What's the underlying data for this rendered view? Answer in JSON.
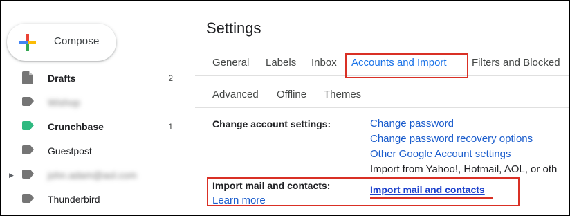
{
  "compose": {
    "label": "Compose"
  },
  "sidebar": {
    "items": [
      {
        "label": "Drafts",
        "count": "2",
        "bold": true,
        "icon": "draft-icon"
      },
      {
        "label": "Wishop",
        "count": "",
        "bold": false,
        "blurred": true,
        "icon": "label-icon",
        "color": "#757575"
      },
      {
        "label": "Crunchbase",
        "count": "1",
        "bold": true,
        "icon": "label-icon",
        "color": "#2fb980"
      },
      {
        "label": "Guestpost",
        "count": "",
        "bold": false,
        "icon": "label-icon",
        "color": "#757575"
      },
      {
        "label": "john.adam@aol.com",
        "count": "",
        "bold": false,
        "blurred": true,
        "expandable": true,
        "icon": "label-icon",
        "color": "#757575"
      },
      {
        "label": "Thunderbird",
        "count": "",
        "bold": false,
        "icon": "label-icon",
        "color": "#757575"
      }
    ]
  },
  "settings": {
    "title": "Settings",
    "tabs": [
      "General",
      "Labels",
      "Inbox",
      "Accounts and Import",
      "Filters and Blocked"
    ],
    "tabs_row2": [
      "Advanced",
      "Offline",
      "Themes"
    ],
    "active_tab": "Accounts and Import"
  },
  "account_section": {
    "label": "Change account settings:",
    "links": [
      "Change password",
      "Change password recovery options",
      "Other Google Account settings"
    ]
  },
  "import_section": {
    "label": "Import mail and contacts:",
    "learn_more": "Learn more",
    "partial_text": "Import from Yahoo!, Hotmail, AOL, or oth",
    "action_link": "Import mail and contacts"
  },
  "colors": {
    "accent": "#1a73e8",
    "highlight": "#d93025",
    "link": "#1a5ccc"
  }
}
